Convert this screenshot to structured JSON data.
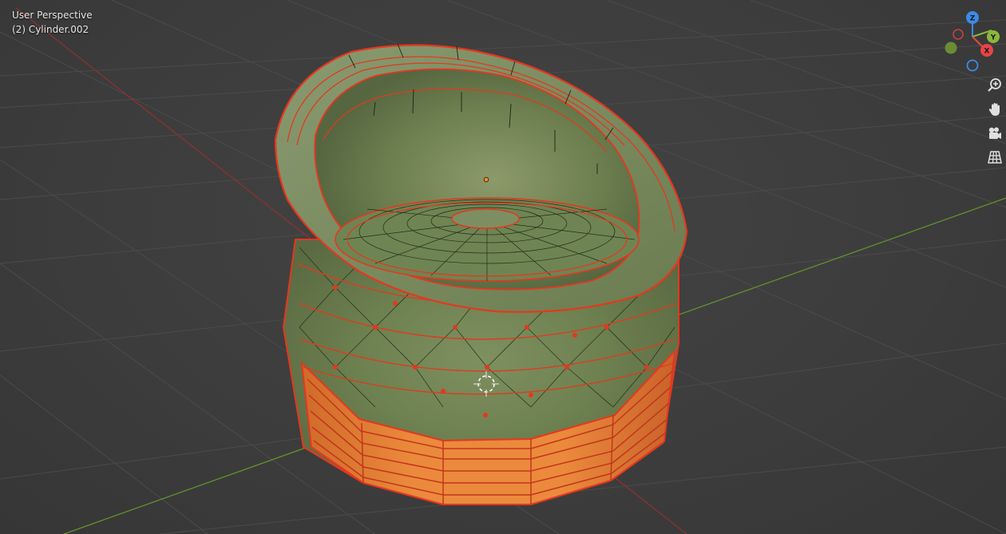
{
  "viewport": {
    "mode_label": "User Perspective",
    "object_label": "(2) Cylinder.002"
  },
  "gizmo": {
    "z_label": "Z",
    "y_label": "Y",
    "x_label": "X",
    "colors": {
      "x": "#e84545",
      "y": "#8ab83a",
      "z": "#3c8ae8"
    }
  },
  "nav_tools": [
    {
      "name": "zoom-icon"
    },
    {
      "name": "pan-hand-icon"
    },
    {
      "name": "camera-icon"
    },
    {
      "name": "orthographic-grid-icon"
    }
  ],
  "colors": {
    "grid": "#4a4a4a",
    "x_axis": "#9a3434",
    "y_axis": "#6a9a2c",
    "selection_outline": "#e8361e",
    "selected_face": "#e8823a",
    "mesh_green": "#7a8c5a"
  }
}
